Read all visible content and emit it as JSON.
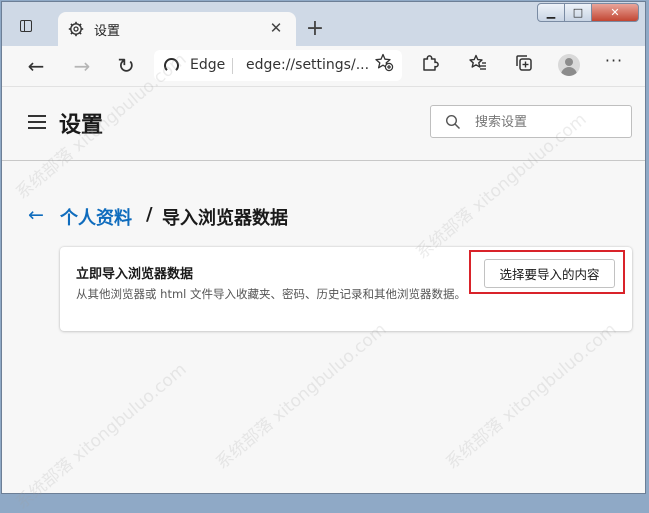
{
  "window": {
    "controls": {
      "minimize": "▁",
      "maximize": "□",
      "close": "✕"
    }
  },
  "tab": {
    "title": "设置",
    "icon": "gear-icon",
    "close_label": "✕",
    "new_tab_label": "+"
  },
  "toolbar": {
    "back": "←",
    "forward": "→",
    "refresh": "↻",
    "site_name": "Edge",
    "url": "edge://settings/...",
    "more": "···",
    "icons": [
      "favorites-star-icon",
      "extensions-icon",
      "favorites-list-icon",
      "collections-icon",
      "profile-avatar"
    ]
  },
  "settings": {
    "title": "设置",
    "search_placeholder": "搜索设置"
  },
  "breadcrumb": {
    "back": "←",
    "parent": "个人资料",
    "separator": "/",
    "current": "导入浏览器数据"
  },
  "import_card": {
    "title": "立即导入浏览器数据",
    "description": "从其他浏览器或 html 文件导入收藏夹、密码、历史记录和其他浏览器数据。",
    "button_label": "选择要导入的内容",
    "highlight_color": "#d9232a"
  },
  "colors": {
    "accent": "#0f6cbd",
    "tab_strip": "#cfd9e6",
    "page_bg": "#f7f7f7"
  },
  "watermark": "系统部落 xitongbuluo.com"
}
